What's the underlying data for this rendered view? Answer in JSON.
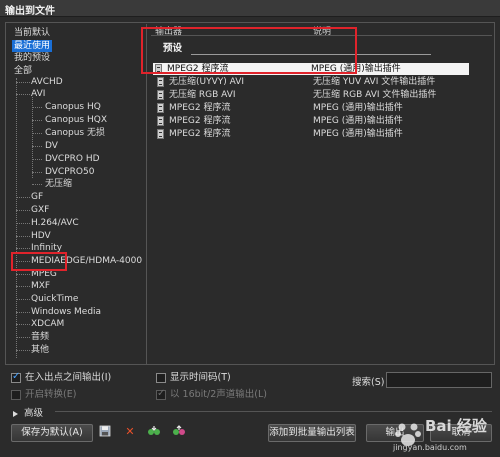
{
  "window": {
    "title": "输出到文件"
  },
  "tree": {
    "items": [
      {
        "label": "当前默认"
      },
      {
        "label": "最近使用"
      },
      {
        "label": "我的预设"
      },
      {
        "label": "全部"
      },
      {
        "label": "AVCHD"
      },
      {
        "label": "AVI"
      },
      {
        "label": "Canopus HQ"
      },
      {
        "label": "Canopus HQX"
      },
      {
        "label": "Canopus 无损"
      },
      {
        "label": "DV"
      },
      {
        "label": "DVCPRO HD"
      },
      {
        "label": "DVCPRO50"
      },
      {
        "label": "无压缩"
      },
      {
        "label": "GF"
      },
      {
        "label": "GXF"
      },
      {
        "label": "H.264/AVC"
      },
      {
        "label": "HDV"
      },
      {
        "label": "Infinity"
      },
      {
        "label": "MEDIAEDGE/HDMA-4000"
      },
      {
        "label": "MPEG"
      },
      {
        "label": "MXF"
      },
      {
        "label": "QuickTime"
      },
      {
        "label": "Windows Media"
      },
      {
        "label": "XDCAM"
      },
      {
        "label": "音频"
      },
      {
        "label": "其他"
      }
    ]
  },
  "list": {
    "columns": {
      "exporter": "输出器",
      "description": "说明"
    },
    "group_label": "预设",
    "rows": [
      {
        "name": "MPEG2 程序流",
        "desc": "MPEG (通用)输出插件"
      },
      {
        "name": "无压缩(UYVY) AVI",
        "desc": "无压缩 YUV AVI 文件输出插件"
      },
      {
        "name": "无压缩 RGB AVI",
        "desc": "无压缩 RGB AVI 文件输出插件"
      },
      {
        "name": "MPEG2 程序流",
        "desc": "MPEG (通用)输出插件"
      },
      {
        "name": "MPEG2 程序流",
        "desc": "MPEG (通用)输出插件"
      },
      {
        "name": "MPEG2 程序流",
        "desc": "MPEG (通用)输出插件"
      }
    ]
  },
  "options": {
    "in_out_only": "在入出点之间输出(I)",
    "enable_convert": "开启转换(E)",
    "show_timecode": "显示时间码(T)",
    "output_16bit": "以 16bit/2声道输出(L)",
    "search_label": "搜索(S)",
    "search_value": ""
  },
  "advanced": {
    "label": "高级"
  },
  "buttons": {
    "save_default": "保存为默认(A)",
    "add_batch": "添加到批量输出列表",
    "output": "输出",
    "cancel": "取消"
  },
  "watermark": {
    "logo": "Bai 经验",
    "url": "jingyan.baidu.com"
  }
}
